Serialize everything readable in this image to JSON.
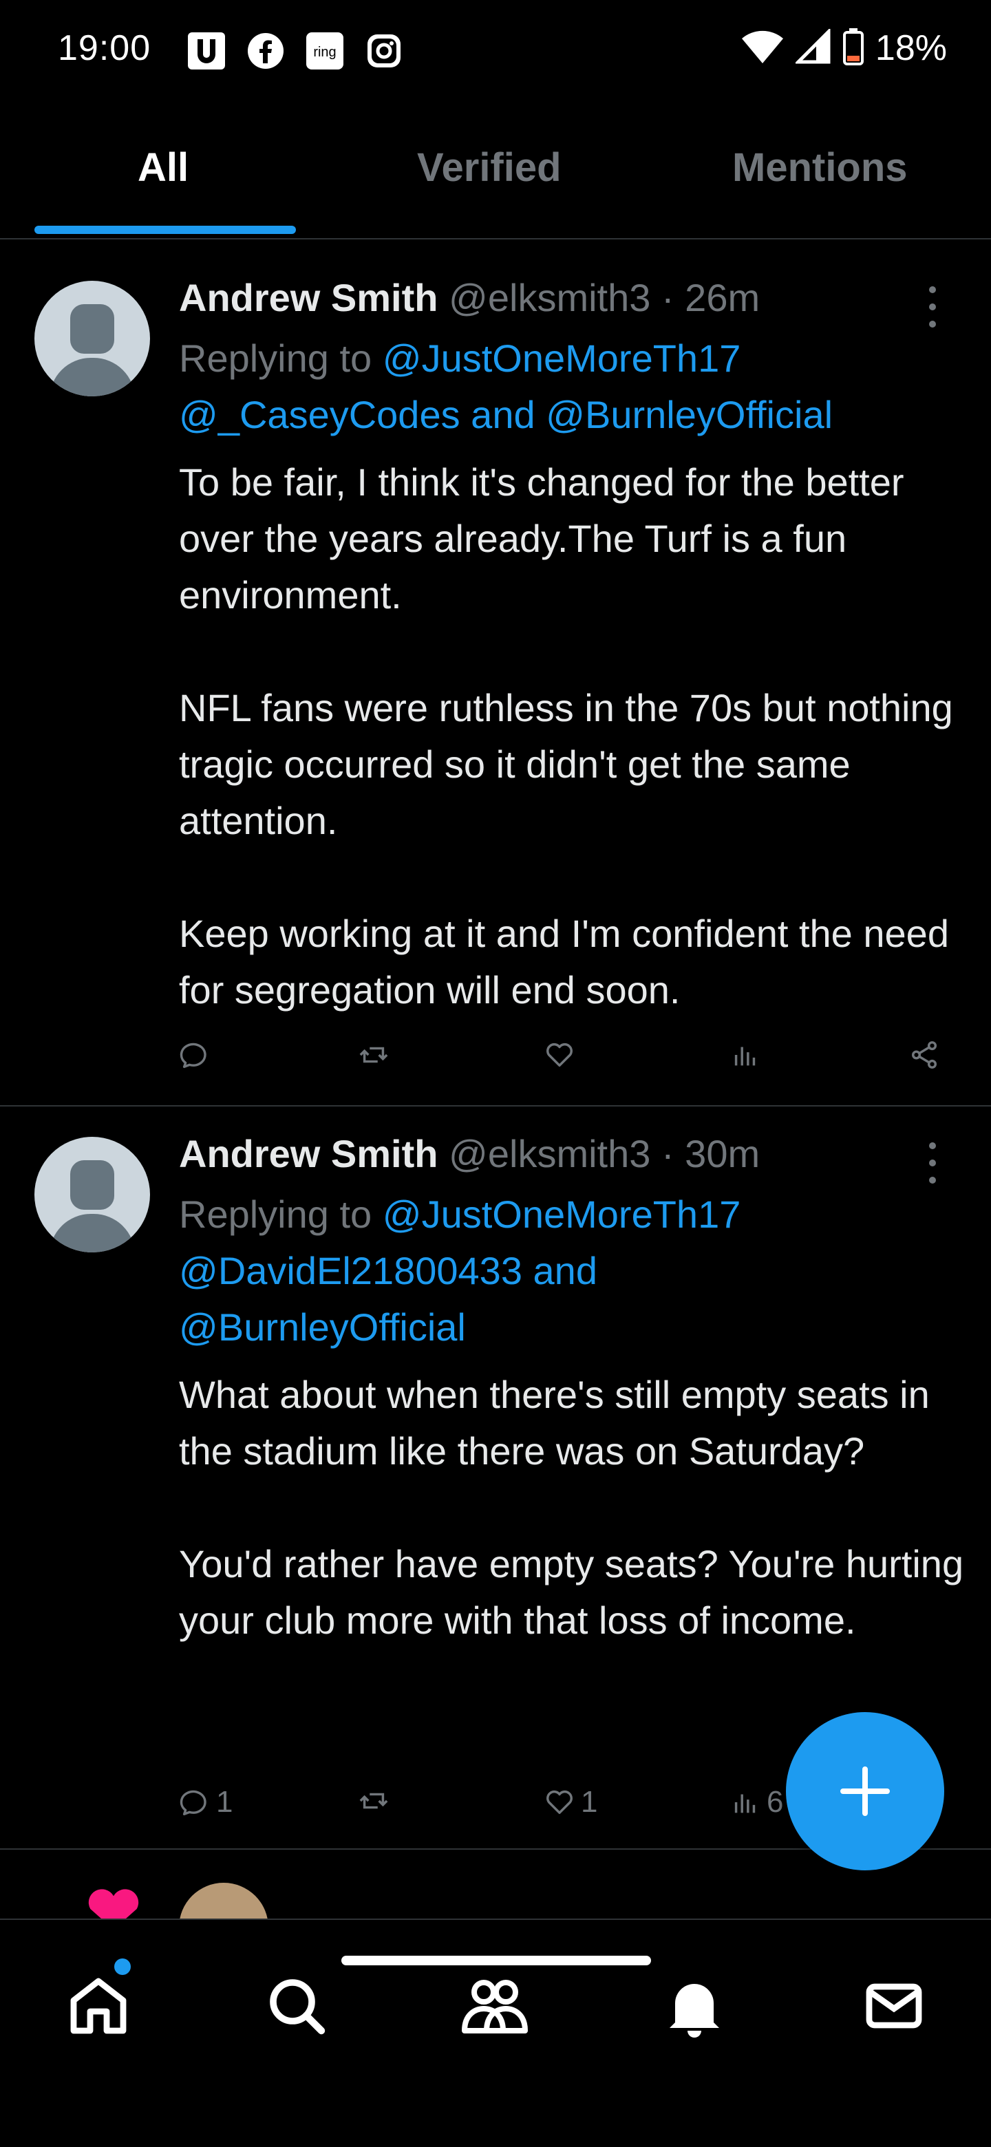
{
  "status_bar": {
    "time": "19:00",
    "app_icons": [
      "u-icon",
      "facebook-icon",
      "ring-icon",
      "instagram-icon"
    ],
    "ring_label": "ring",
    "battery": "18%"
  },
  "tabs": [
    {
      "label": "All",
      "active": true
    },
    {
      "label": "Verified",
      "active": false
    },
    {
      "label": "Mentions",
      "active": false
    }
  ],
  "tweets": [
    {
      "name": "Andrew Smith",
      "handle": "@elksmith3",
      "separator": " · ",
      "time": "26m",
      "replying_to": "Replying to ",
      "mentions_line1": "@JustOneMoreTh17",
      "mentions_line2a": "@_CaseyCodes",
      "mentions_and": " and ",
      "mentions_line2b": "@BurnleyOfficial",
      "mentions_line3": "",
      "paragraphs": [
        "To be fair, I think it's changed for the better over the years already.The Turf is a fun environment.",
        "NFL fans were ruthless in the 70s but nothing tragic occurred so it didn't get the same attention.",
        "Keep working at it and I'm confident the need for segregation will end soon."
      ],
      "reply_count": "",
      "retweet_count": "",
      "like_count": "",
      "view_count": ""
    },
    {
      "name": "Andrew Smith",
      "handle": "@elksmith3",
      "separator": " · ",
      "time": "30m",
      "replying_to": "Replying to ",
      "mentions_line1": "@JustOneMoreTh17",
      "mentions_line2a": "@DavidEl21800433",
      "mentions_and": " and",
      "mentions_line2b": "",
      "mentions_line3": "@BurnleyOfficial",
      "paragraphs": [
        "What about when there's still empty seats in the stadium like there was on Saturday?",
        "You'd rather have empty seats?  You're hurting your club more with that loss of income."
      ],
      "reply_count": "1",
      "retweet_count": "",
      "like_count": "1",
      "view_count": "6"
    }
  ],
  "colors": {
    "accent": "#1d9bf0",
    "background": "#000000",
    "text": "#e7e9ea",
    "muted": "#71767b",
    "like_pink": "#f91880"
  },
  "bottom_nav": [
    "home-icon",
    "search-icon",
    "communities-icon",
    "notifications-icon",
    "messages-icon"
  ]
}
